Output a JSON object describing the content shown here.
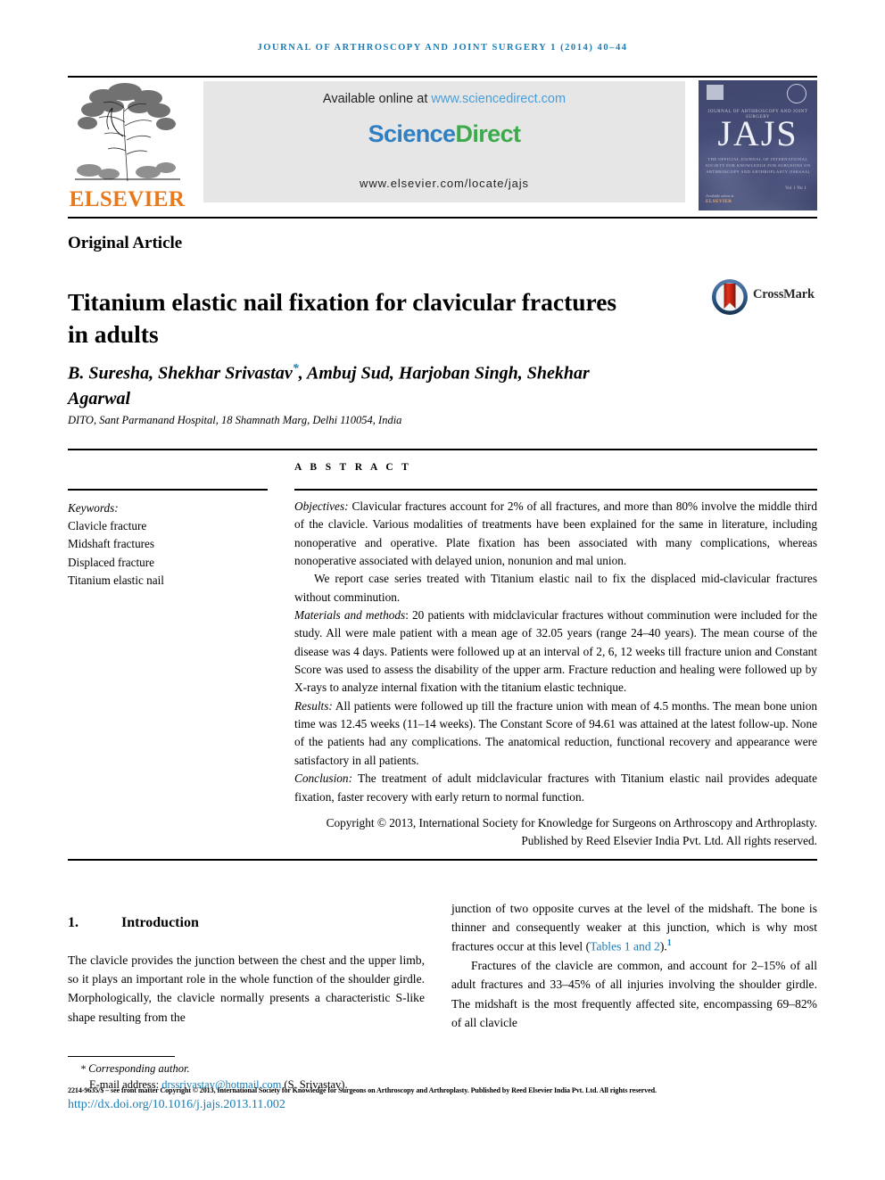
{
  "running_head": "Journal of Arthroscopy and Joint Surgery 1 (2014) 40–44",
  "masthead": {
    "publisher_name": "ELSEVIER",
    "publisher_logo_alt": "elsevier-tree-logo",
    "available_online_prefix": "Available online at ",
    "available_online_url": "www.sciencedirect.com",
    "sciencedirect_science": "Science",
    "sciencedirect_direct": "Direct",
    "locate_url": "www.elsevier.com/locate/jajs",
    "cover": {
      "small_title": "JOURNAL OF ARTHROSCOPY AND JOINT SURGERY",
      "acronym": "JAJS",
      "subtitle": "THE OFFICIAL JOURNAL OF INTERNATIONAL SOCIETY FOR KNOWLEDGE FOR SURGEONS ON ARTHROSCOPY AND ARTHROPLASTY (ISKSAA)",
      "issue": "Vol 1 No 1",
      "footer_publisher": "ELSEVIER",
      "footer_label": "Available online at"
    }
  },
  "article": {
    "type": "Original Article",
    "title": "Titanium elastic nail fixation for clavicular fractures in adults",
    "crossmark_label": "CrossMark",
    "authors": "B. Suresha, Shekhar Srivastav",
    "author_star": "*",
    "authors_cont": ", Ambuj Sud, Harjoban Singh, Shekhar Agarwal",
    "affiliation": "DITO, Sant Parmanand Hospital, 18 Shamnath Marg, Delhi 110054, India"
  },
  "abstract_block": {
    "label": "A B S T R A C T",
    "keywords_heading": "Keywords:",
    "keywords": [
      "Clavicle fracture",
      "Midshaft fractures",
      "Displaced fracture",
      "Titanium elastic nail"
    ],
    "objectives_label": "Objectives:",
    "objectives_text": " Clavicular fractures account for 2% of all fractures, and more than 80% involve the middle third of the clavicle. Various modalities of treatments have been explained for the same in literature, including nonoperative and operative. Plate fixation has been associated with many complications, whereas nonoperative associated with delayed union, nonunion and mal union.",
    "report_text": "We report case series treated with Titanium elastic nail to fix the displaced mid-clavicular fractures without comminution.",
    "materials_label": "Materials and methods",
    "materials_text": ": 20 patients with midclavicular fractures without comminution were included for the study. All were male patient with a mean age of 32.05 years (range 24–40 years). The mean course of the disease was 4 days. Patients were followed up at an interval of 2, 6, 12 weeks till fracture union and Constant Score was used to assess the disability of the upper arm. Fracture reduction and healing were followed up by X-rays to analyze internal fixation with the titanium elastic technique.",
    "results_label": "Results:",
    "results_text": " All patients were followed up till the fracture union with mean of 4.5 months. The mean bone union time was 12.45 weeks (11–14 weeks). The Constant Score of 94.61 was attained at the latest follow-up. None of the patients had any complications. The anatomical reduction, functional recovery and appearance were satisfactory in all patients.",
    "conclusion_label": "Conclusion:",
    "conclusion_text": " The treatment of adult midclavicular fractures with Titanium elastic nail provides adequate fixation, faster recovery with early return to normal function.",
    "copyright": "Copyright © 2013, International Society for Knowledge for Surgeons on Arthroscopy and Arthroplasty. Published by Reed Elsevier India Pvt. Ltd. All rights reserved."
  },
  "body": {
    "section_number": "1.",
    "section_title": "Introduction",
    "left_paragraph": "The clavicle provides the junction between the chest and the upper limb, so it plays an important role in the whole function of the shoulder girdle. Morphologically, the clavicle normally presents a characteristic S-like shape resulting from the",
    "right_paragraph_1_pre": "junction of two opposite curves at the level of the midshaft. The bone is thinner and consequently weaker at this junction, which is why most fractures occur at this level (",
    "right_paragraph_1_link": "Tables 1 and 2",
    "right_paragraph_1_post": ").",
    "right_paragraph_1_sup": "1",
    "right_paragraph_2": "Fractures of the clavicle are common, and account for 2–15% of all adult fractures and 33–45% of all injuries involving the shoulder girdle. The midshaft is the most frequently affected site, encompassing 69–82% of all clavicle"
  },
  "footer": {
    "corresponding_star": "*",
    "corresponding_label": "Corresponding author.",
    "email_label": "E-mail address:",
    "email": "drssrivastav@hotmail.com",
    "email_owner": "(S. Srivastav).",
    "issn_line": "2214-9635/$ – see front matter Copyright © 2013, International Society for Knowledge for Surgeons on Arthroscopy and Arthroplasty. Published by Reed Elsevier India Pvt. Ltd. All rights reserved.",
    "doi": "http://dx.doi.org/10.1016/j.jajs.2013.11.002"
  },
  "colors": {
    "link_blue": "#1a7cb5",
    "elsevier_orange": "#e8791b",
    "sciencedirect_green": "#3bab4b",
    "sciencedirect_blue": "#2f7fc1",
    "cover_navy": "#3c4470"
  }
}
